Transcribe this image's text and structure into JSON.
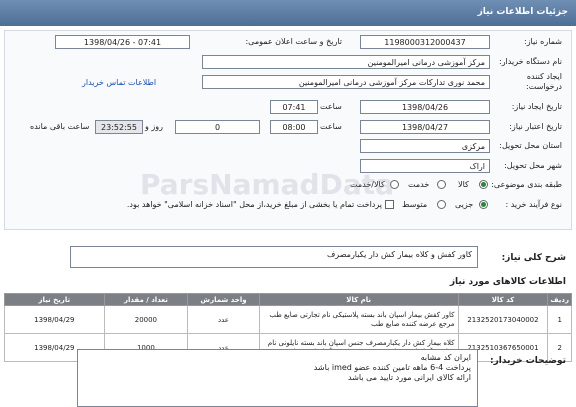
{
  "header": {
    "title": "جزئیات اطلاعات نیاز"
  },
  "form": {
    "need_number": {
      "label": "شماره نیاز:",
      "value": "1198000312000437"
    },
    "announce": {
      "label": "تاریخ و ساعت اعلان عمومی:",
      "value": "1398/04/26 - 07:41"
    },
    "buyer_org": {
      "label": "نام دستگاه خریدار:",
      "value": "مرکز آموزشی درمانی امیرالمومنین"
    },
    "requester": {
      "label": "ایجاد کننده درخواست:",
      "value": "محمد نوری تدارکات مرکز آموزشی درمانی امیرالمومنین",
      "contact_link": "اطلاعات تماس خریدار"
    },
    "created": {
      "label": "تاریخ ایجاد نیاز:",
      "date": "1398/04/26",
      "time_label": "ساعت",
      "time": "07:41"
    },
    "deadline": {
      "label": "تاریخ اعتبار نیاز:",
      "date": "1398/04/27",
      "time_label": "ساعت",
      "time": "08:00",
      "days_label": "روز و",
      "days": "0",
      "remaining": "23:52:55",
      "remaining_label": "ساعت باقی مانده"
    },
    "province": {
      "label": "استان محل تحویل:",
      "value": "مرکزی"
    },
    "city": {
      "label": "شهر محل تحویل:",
      "value": "اراک"
    },
    "category": {
      "label": "طبقه بندی موضوعی:",
      "options": [
        "کالا",
        "خدمت",
        "کالا/خدمت"
      ],
      "selected": "کالا"
    },
    "purchase_type": {
      "label": "نوع فرآیند خرید :",
      "options": [
        "جزیی",
        "متوسط"
      ],
      "selected": "جزیی",
      "payment_note": "پرداخت تمام یا بخشی از مبلغ خرید،از محل \"اسناد خزانه اسلامی\" خواهد بود."
    }
  },
  "summary": {
    "label": "شرح کلی نیاز:",
    "value": "کاور کفش و کلاه بیمار کش دار یکبارمصرف"
  },
  "items_section": {
    "title": "اطلاعات کالاهای مورد نیاز",
    "columns": [
      "ردیف",
      "کد کالا",
      "نام کالا",
      "واحد شمارش",
      "تعداد / مقدار",
      "تاریخ نیاز"
    ],
    "rows": [
      {
        "idx": "1",
        "code": "2132520173040002",
        "name": "کاور کفش بیمار اسپان باند بسته پلاستیکی نام تجارتی صایع طب مرجع عرضه کننده صایع طب",
        "unit": "عدد",
        "qty": "20000",
        "date": "1398/04/29"
      },
      {
        "idx": "2",
        "code": "2132510367650001",
        "name": "کلاه بیمار کش دار یکبارمصرف جنس اسپان باند بسته نایلونی نام تجارتی آریا طب پزنیان مرجع عرضه کننده آریا طب پزنیان",
        "unit": "عدد",
        "qty": "1000",
        "date": "1398/04/29"
      }
    ]
  },
  "buyer_notes": {
    "label": "توضیحات خریدار:",
    "lines": [
      "ایران کد مشابه",
      "پرداخت 4-6 ماهه تامین کننده عضو imed باشد",
      "ارائه کالای ایرانی مورد تایید می باشد"
    ]
  },
  "watermark": "ParsNamadData"
}
